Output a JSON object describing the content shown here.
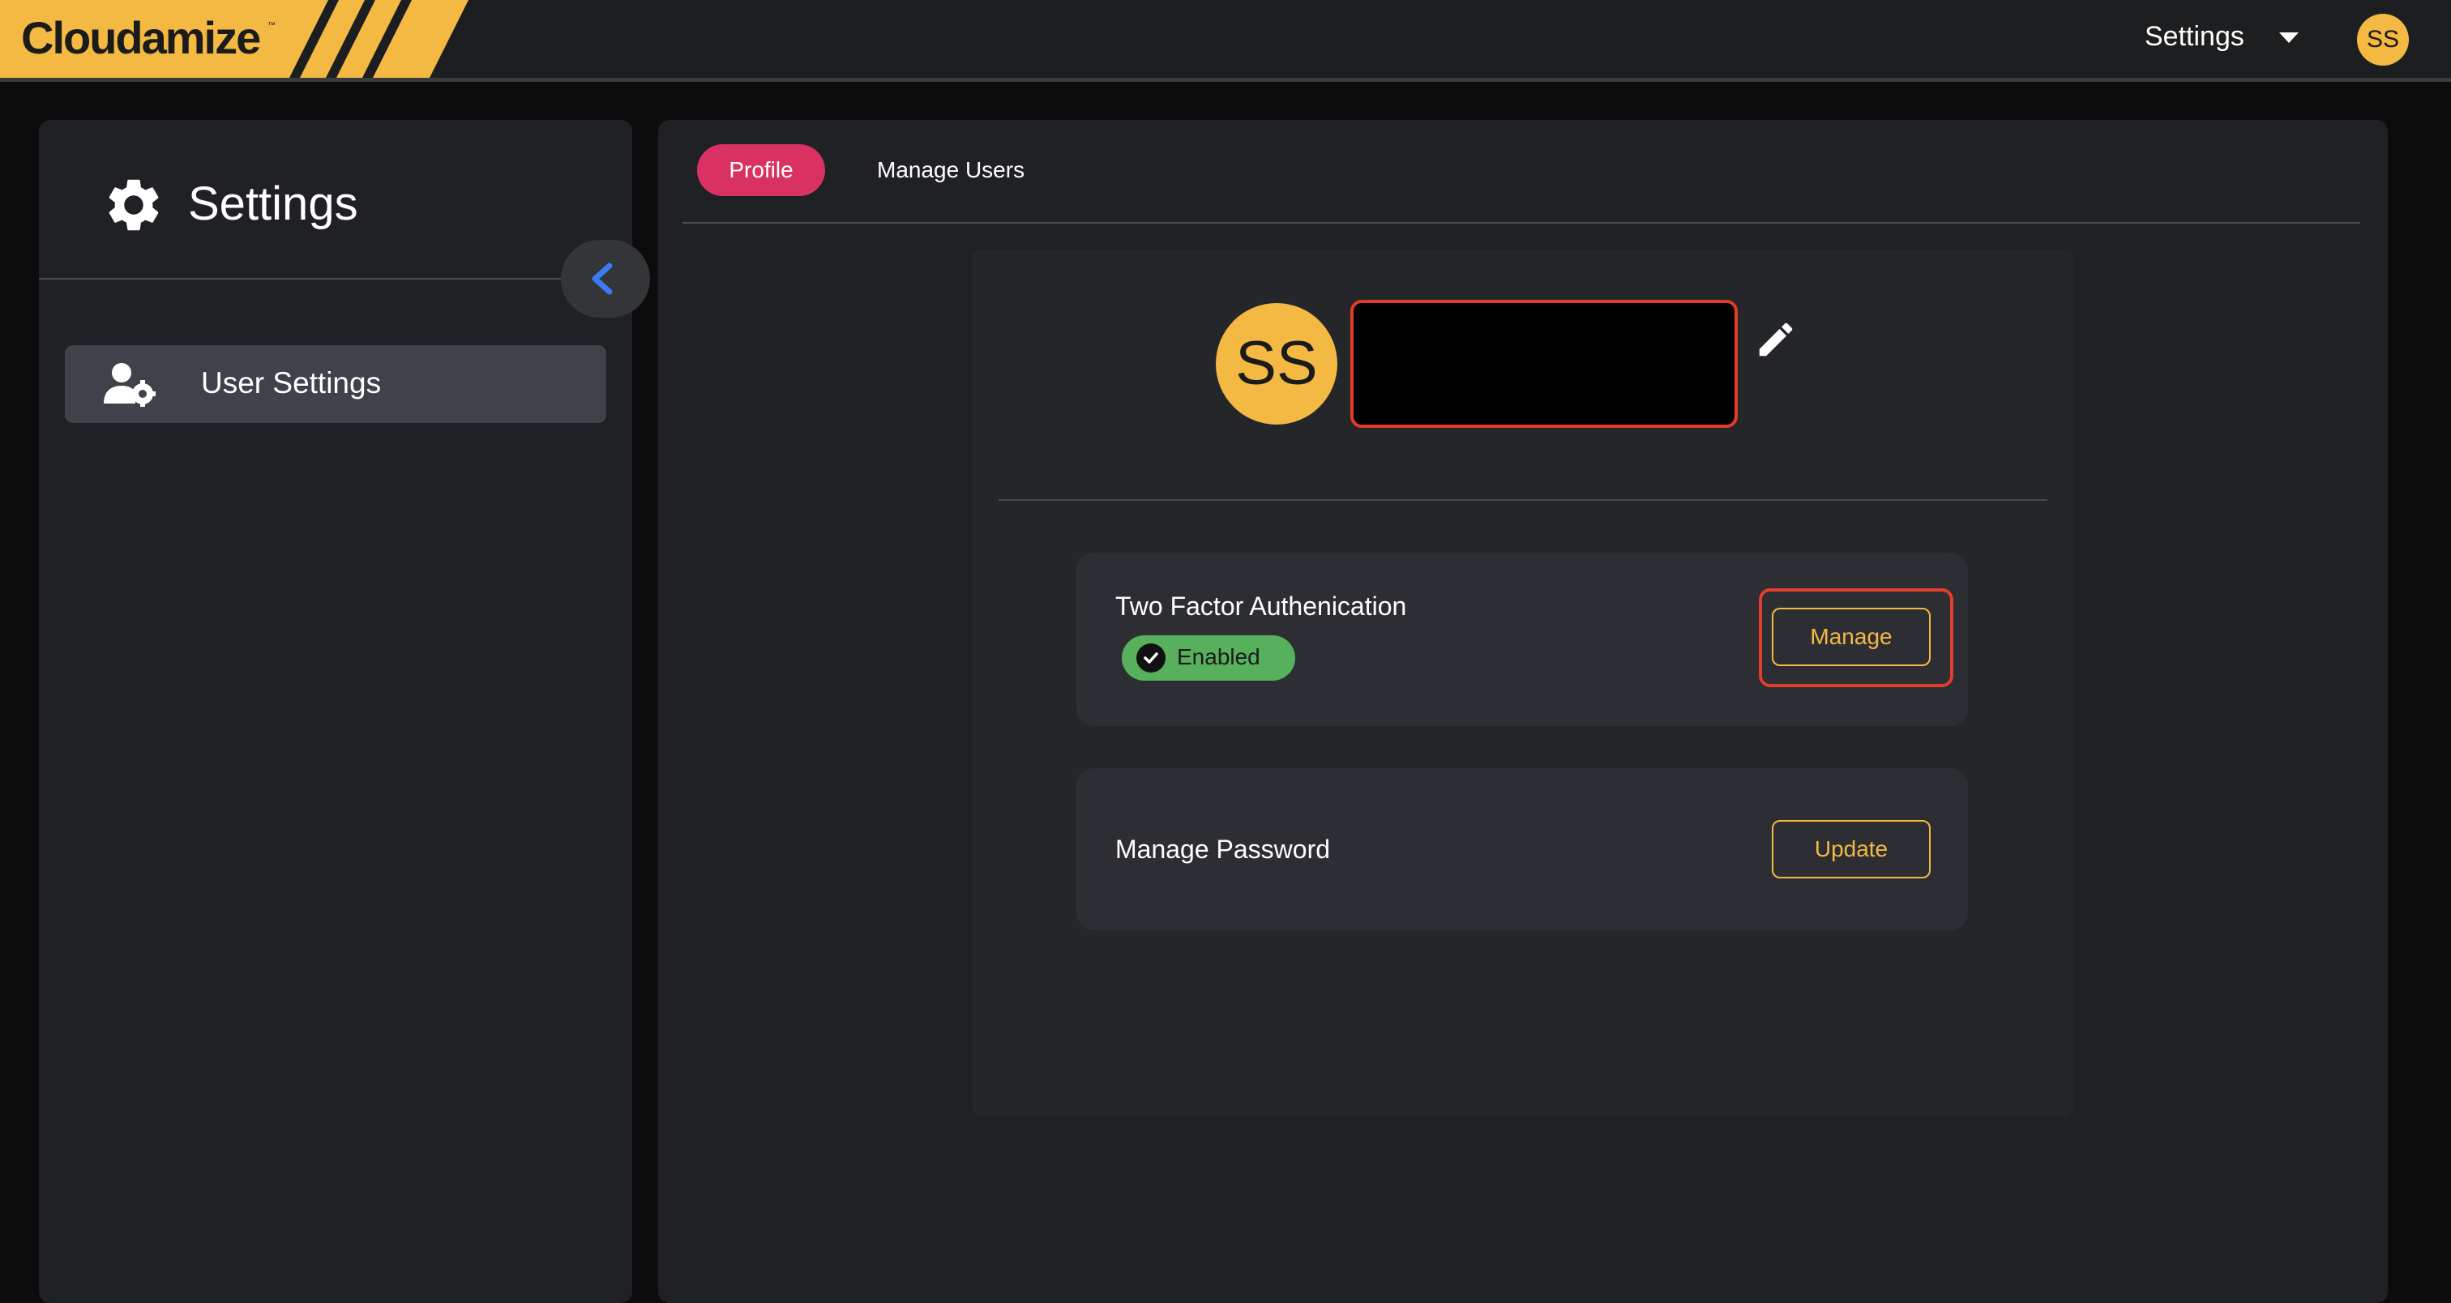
{
  "header": {
    "brand": "Cloudamize",
    "brand_tm": "™",
    "settings_label": "Settings",
    "avatar_initials": "SS"
  },
  "sidebar": {
    "title": "Settings",
    "items": [
      {
        "label": "User Settings",
        "icon": "user-gear-icon",
        "active": true
      }
    ]
  },
  "tabs": [
    {
      "label": "Profile",
      "active": true
    },
    {
      "label": "Manage Users",
      "active": false
    }
  ],
  "profile": {
    "avatar_initials": "SS",
    "name": "",
    "two_factor": {
      "label": "Two Factor Authenication",
      "status": "Enabled",
      "button_label": "Manage"
    },
    "password": {
      "label": "Manage Password",
      "button_label": "Update"
    }
  },
  "colors": {
    "brand_yellow": "#f3b942",
    "active_tab": "#d93262",
    "enabled_green": "#57b05c",
    "highlight_red": "#e23c2b",
    "collapse_arrow": "#3b7cf5"
  }
}
